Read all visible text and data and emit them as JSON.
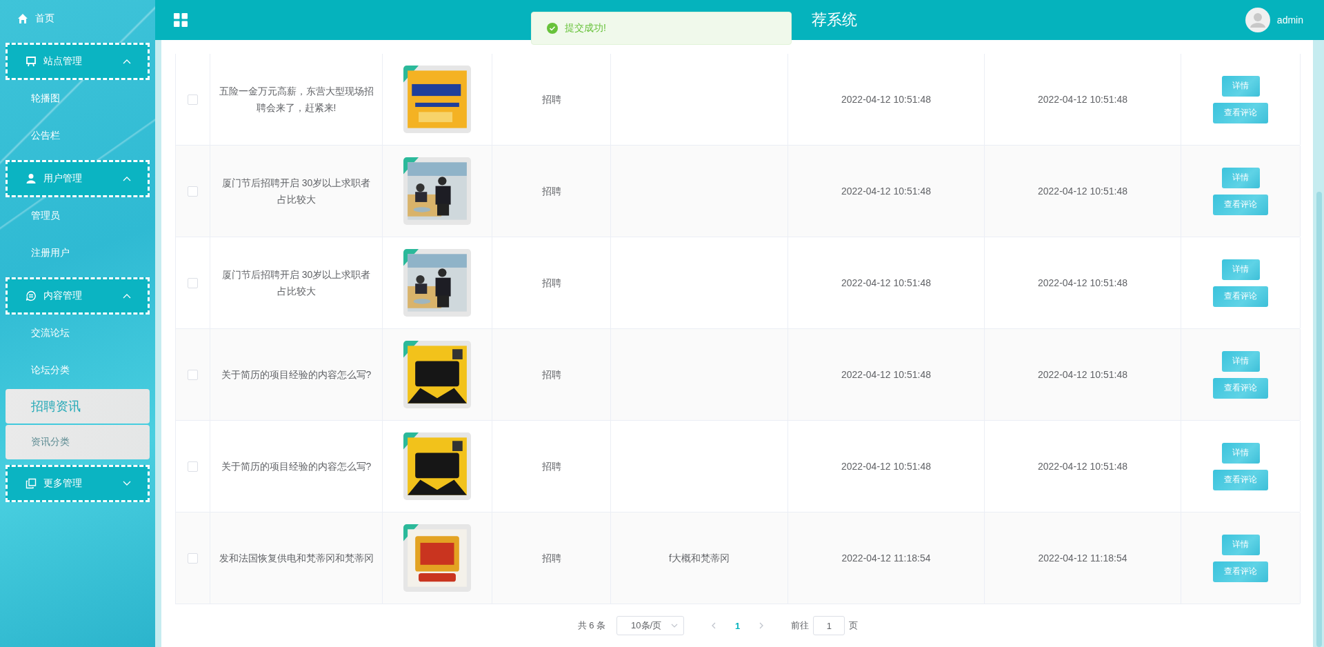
{
  "header": {
    "title": "荐系统",
    "user": "admin"
  },
  "toast": {
    "message": "提交成功!"
  },
  "sidebar": {
    "items": [
      {
        "kind": "link",
        "label": "首页"
      },
      {
        "kind": "group",
        "label": "站点管理",
        "expanded": true,
        "children": [
          {
            "label": "轮播图",
            "selected": false,
            "hovered": false
          },
          {
            "label": "公告栏",
            "selected": false,
            "hovered": false
          }
        ]
      },
      {
        "kind": "group",
        "label": "用户管理",
        "expanded": true,
        "children": [
          {
            "label": "管理员",
            "selected": false,
            "hovered": false
          },
          {
            "label": "注册用户",
            "selected": false,
            "hovered": false
          }
        ]
      },
      {
        "kind": "group",
        "label": "内容管理",
        "expanded": true,
        "children": [
          {
            "label": "交流论坛",
            "selected": false,
            "hovered": false
          },
          {
            "label": "论坛分类",
            "selected": false,
            "hovered": false
          },
          {
            "label": "招聘资讯",
            "selected": true,
            "hovered": false
          },
          {
            "label": "资讯分类",
            "selected": false,
            "hovered": true
          }
        ]
      },
      {
        "kind": "group",
        "label": "更多管理",
        "expanded": false
      }
    ]
  },
  "table": {
    "rows": [
      {
        "checked": false,
        "title": "五险一金万元高薪，东营大型现场招聘会来了，赶紧来!",
        "category": "招聘",
        "created": "2022-04-12 10:51:48",
        "updated": "2022-04-12 10:51:48",
        "actions": [
          "详情",
          "查看评论"
        ]
      },
      {
        "checked": false,
        "title": "厦门节后招聘开启 30岁以上求职者占比较大",
        "category": "招聘",
        "created": "2022-04-12 10:51:48",
        "updated": "2022-04-12 10:51:48",
        "actions": [
          "详情",
          "查看评论"
        ]
      },
      {
        "checked": false,
        "title": "厦门节后招聘开启 30岁以上求职者占比较大",
        "category": "招聘",
        "created": "2022-04-12 10:51:48",
        "updated": "2022-04-12 10:51:48",
        "actions": [
          "详情",
          "查看评论"
        ]
      },
      {
        "checked": false,
        "title": "关于简历的项目经验的内容怎么写?",
        "category": "招聘",
        "created": "2022-04-12 10:51:48",
        "updated": "2022-04-12 10:51:48",
        "actions": [
          "详情",
          "查看评论"
        ]
      },
      {
        "checked": false,
        "title": "关于简历的项目经验的内容怎么写?",
        "category": "招聘",
        "created": "2022-04-12 10:51:48",
        "updated": "2022-04-12 10:51:48",
        "actions": [
          "详情",
          "查看评论"
        ]
      },
      {
        "checked": false,
        "title": "发和法国恢复供电和梵蒂冈和梵蒂冈",
        "category": "招聘",
        "column_5": "f大概和梵蒂冈",
        "created": "2022-04-12 11:18:54",
        "updated": "2022-04-12 11:18:54",
        "actions": [
          "详情",
          "查看评论"
        ]
      }
    ]
  },
  "pagination": {
    "total": "共 6 条",
    "page_size": "10条/页",
    "pages": [
      {
        "label": "1",
        "selected": true
      }
    ],
    "goto_label": "前往",
    "goto_value": "1",
    "goto_suffix": "页"
  }
}
